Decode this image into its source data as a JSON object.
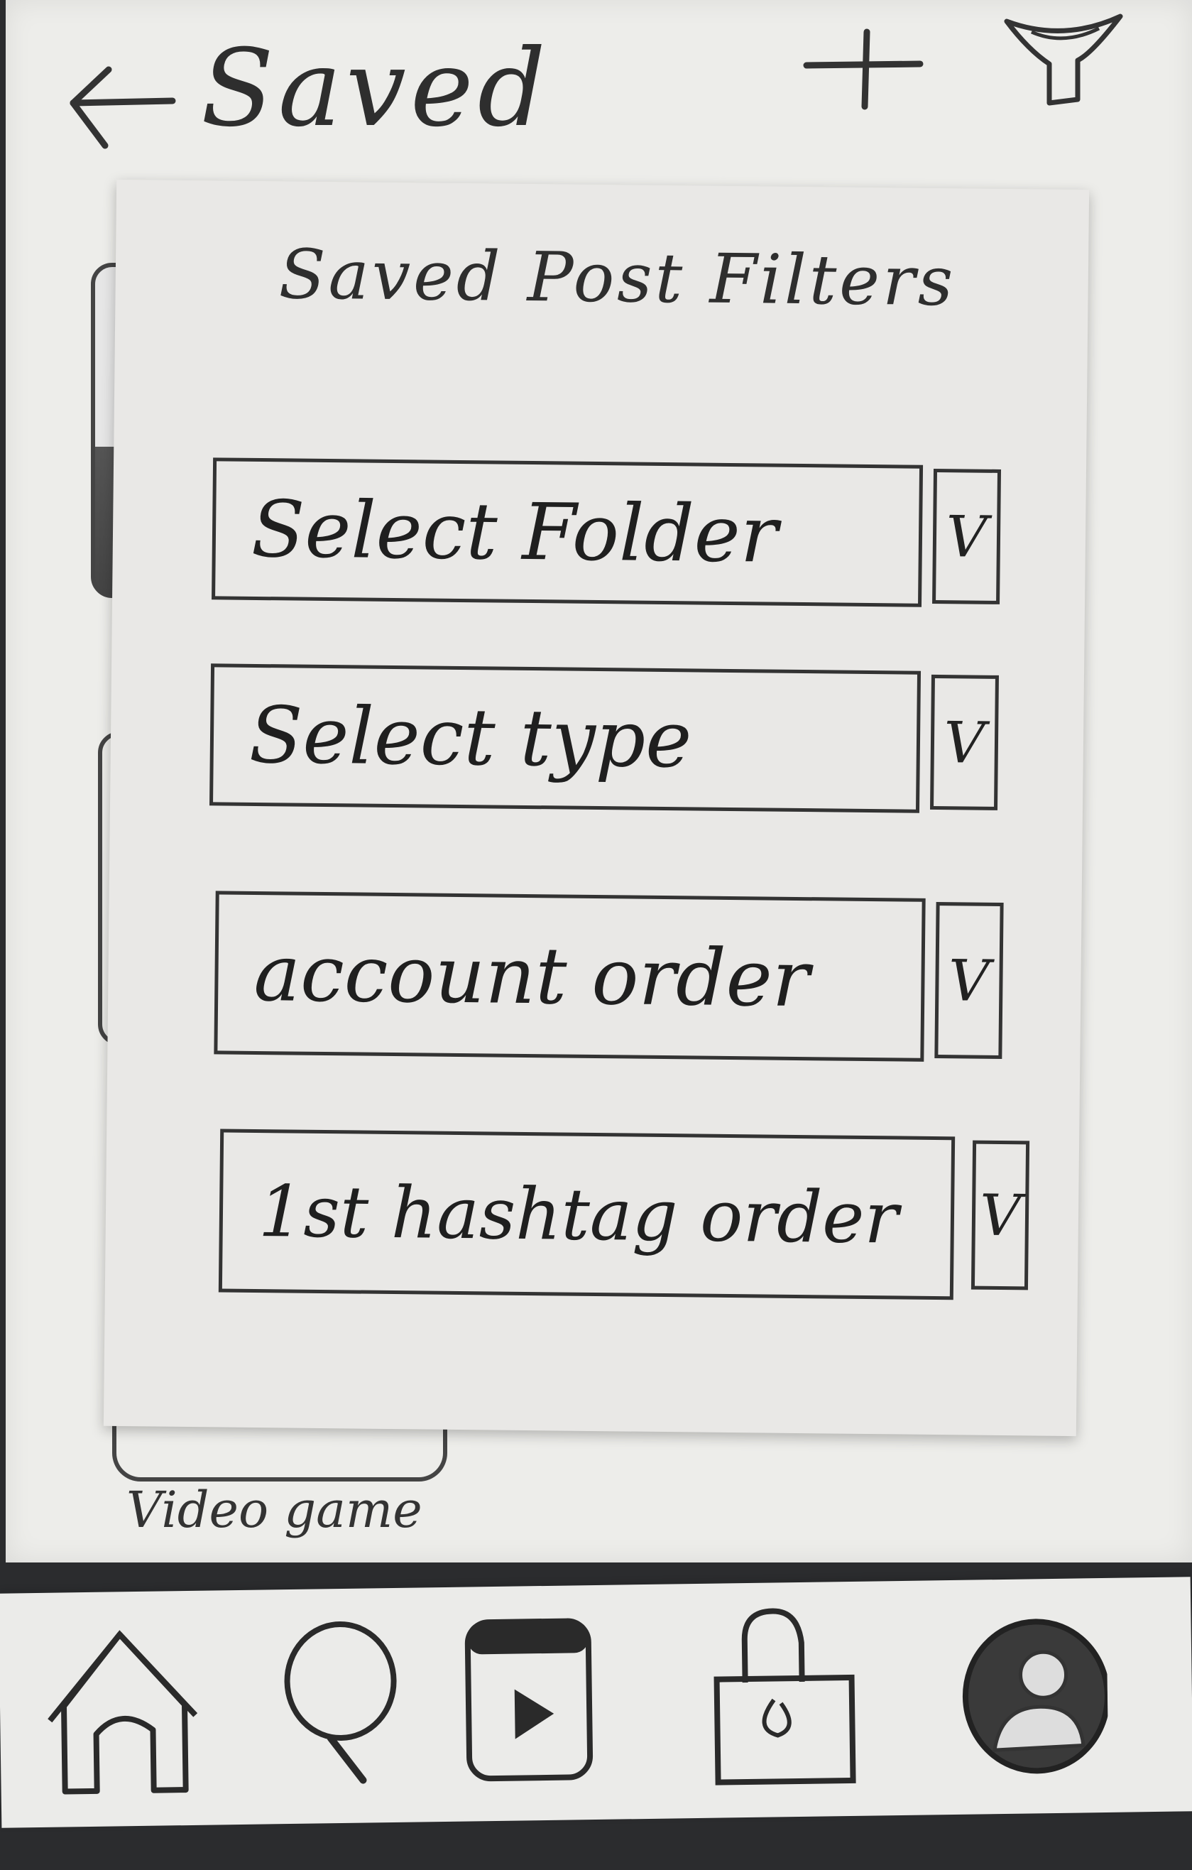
{
  "header": {
    "title": "Saved",
    "back_icon": "arrow-left-icon",
    "add_icon": "plus-icon",
    "filter_icon": "funnel-icon"
  },
  "background": {
    "caption": "Video game"
  },
  "filter_panel": {
    "title": "Saved Post Filters",
    "dropdowns": [
      {
        "label": "Select Folder",
        "indicator": "V"
      },
      {
        "label": "Select type",
        "indicator": "V"
      },
      {
        "label": "account order",
        "indicator": "V"
      },
      {
        "label": "1st hashtag order",
        "indicator": "V"
      }
    ]
  },
  "bottom_nav": {
    "items": [
      {
        "icon": "home-icon"
      },
      {
        "icon": "search-icon"
      },
      {
        "icon": "reels-icon"
      },
      {
        "icon": "lock-icon"
      },
      {
        "icon": "profile-icon"
      }
    ]
  }
}
